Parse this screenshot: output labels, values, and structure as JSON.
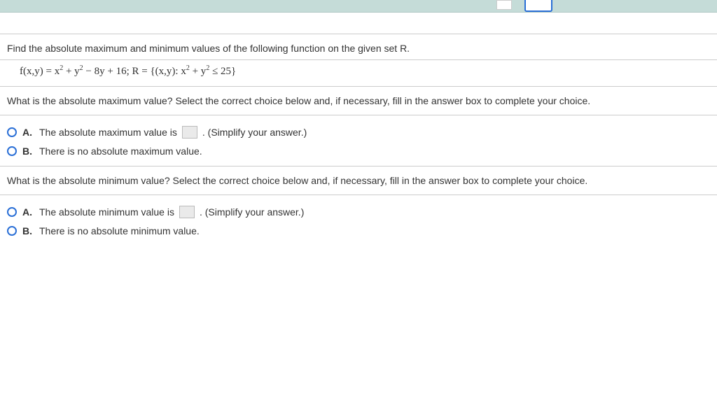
{
  "intro": "Find the absolute maximum and minimum values of the following function on the given set R.",
  "equation": {
    "prefix": "f(x,y) = x",
    "sq1": "2",
    "mid1": " + y",
    "sq2": "2",
    "mid2": " − 8y + 16; R = {(x,y): x",
    "sq3": "2",
    "mid3": " + y",
    "sq4": "2",
    "tail": " ≤ 25}"
  },
  "q1": {
    "prompt": "What is the absolute maximum value? Select the correct choice below and, if necessary, fill in the answer box to complete your choice.",
    "a_pre": "The absolute maximum value is",
    "a_post": ". (Simplify your answer.)",
    "b": "There is no absolute maximum value."
  },
  "q2": {
    "prompt": "What is the absolute minimum value? Select the correct choice below and, if necessary, fill in the answer box to complete your choice.",
    "a_pre": "The absolute minimum value is",
    "a_post": ". (Simplify your answer.)",
    "b": "There is no absolute minimum value."
  },
  "labels": {
    "A": "A.",
    "B": "B."
  }
}
